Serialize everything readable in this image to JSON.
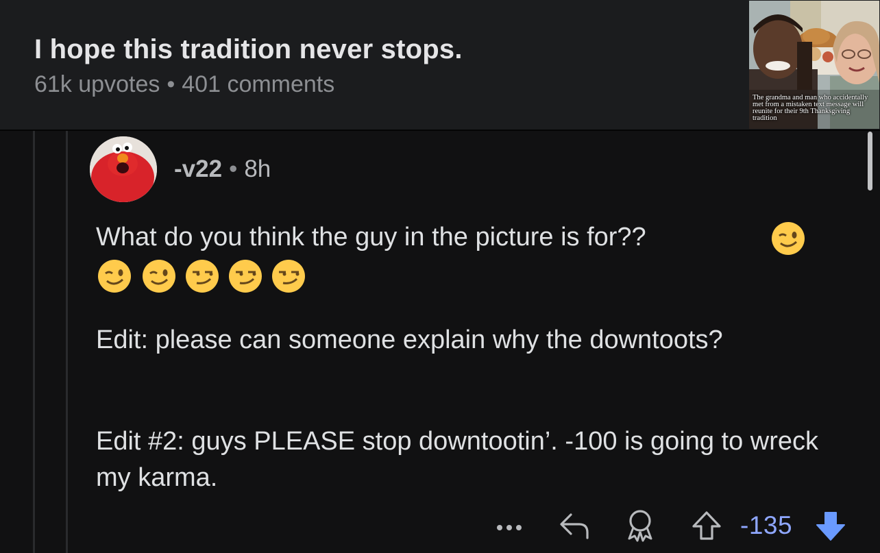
{
  "post": {
    "title": "I hope this tradition never stops.",
    "upvotes": "61k upvotes",
    "separator": "•",
    "comments": "401 comments",
    "thumbnail_caption": "The grandma and man who accidentally met from a mistaken text message will reunite for their 9th Thanksgiving tradition"
  },
  "comment": {
    "username": "-v22",
    "separator": "•",
    "time": "8h",
    "paragraphs": [
      "What do you think the guy in the picture is for??",
      "Edit: please can someone explain why the downtoots?",
      "Edit #2: guys PLEASE stop downtootin’. -100 is going to wreck my karma."
    ],
    "emojis": [
      "winking-face",
      "winking-face",
      "winking-face",
      "smirking-face",
      "smirking-face",
      "smirking-face"
    ],
    "score": "-135"
  },
  "icons": {
    "more": "more-options-icon",
    "reply": "reply-icon",
    "award": "award-icon",
    "upvote": "upvote-icon",
    "downvote": "downvote-icon"
  },
  "colors": {
    "background": "#111112",
    "header_background": "#1b1c1e",
    "score": "#8fa7ff",
    "downvote_active": "#6a9aff"
  }
}
